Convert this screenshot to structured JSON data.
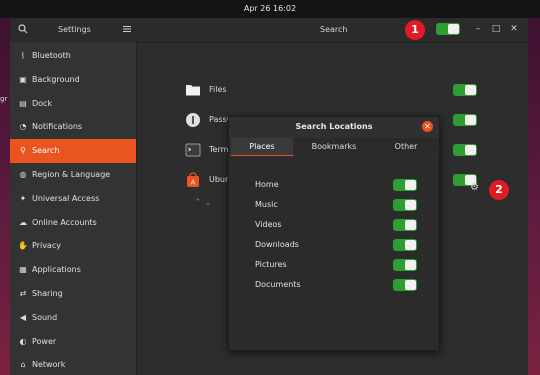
{
  "topbar": {
    "datetime": "Apr 26  16:02"
  },
  "desktop": {
    "left_text": "gr"
  },
  "window": {
    "title": "Settings",
    "main_title": "Search",
    "minimize": "–",
    "maximize": "□",
    "close": "✕"
  },
  "sidebar": {
    "items": [
      {
        "label": "Bluetooth",
        "icon": "ᛒ"
      },
      {
        "label": "Background",
        "icon": "▣"
      },
      {
        "label": "Dock",
        "icon": "▤"
      },
      {
        "label": "Notifications",
        "icon": "◔"
      },
      {
        "label": "Search",
        "icon": "⚲"
      },
      {
        "label": "Region & Language",
        "icon": "◍"
      },
      {
        "label": "Universal Access",
        "icon": "✦"
      },
      {
        "label": "Online Accounts",
        "icon": "☁"
      },
      {
        "label": "Privacy",
        "icon": "✋"
      },
      {
        "label": "Applications",
        "icon": "▦"
      },
      {
        "label": "Sharing",
        "icon": "⇄"
      },
      {
        "label": "Sound",
        "icon": "◀"
      },
      {
        "label": "Power",
        "icon": "◐"
      },
      {
        "label": "Network",
        "icon": "⌂"
      }
    ],
    "active_index": 4
  },
  "main": {
    "rows": [
      {
        "label": "Files",
        "enabled": true
      },
      {
        "label": "Passwords and Keys",
        "enabled": true
      },
      {
        "label": "Term",
        "enabled": true
      },
      {
        "label": "Ubun",
        "enabled": true
      }
    ],
    "chevrons": "⌃ ⌄"
  },
  "annotations": {
    "badge1": "1",
    "badge2": "2"
  },
  "dialog": {
    "title": "Search Locations",
    "close": "✕",
    "tabs": [
      "Places",
      "Bookmarks",
      "Other"
    ],
    "active_tab": 0,
    "places": [
      {
        "label": "Home",
        "enabled": true
      },
      {
        "label": "Music",
        "enabled": true
      },
      {
        "label": "Videos",
        "enabled": true
      },
      {
        "label": "Downloads",
        "enabled": true
      },
      {
        "label": "Pictures",
        "enabled": true
      },
      {
        "label": "Documents",
        "enabled": true
      }
    ]
  },
  "colors": {
    "accent": "#e95420",
    "switch_on": "#2f9e32",
    "badge": "#e01b24"
  }
}
